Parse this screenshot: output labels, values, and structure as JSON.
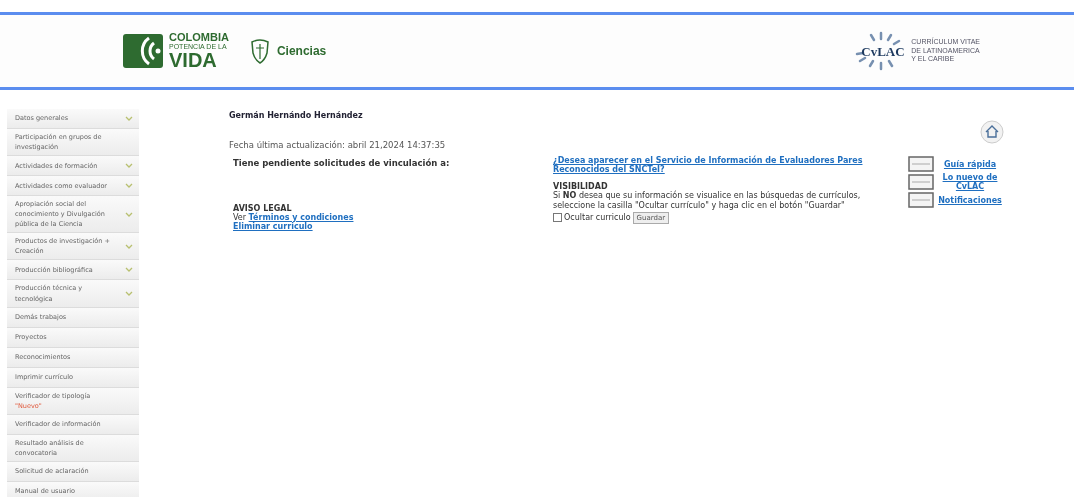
{
  "header": {
    "brand": {
      "line1": "COLOMBIA",
      "line2": "POTENCIA DE LA",
      "line3": "VIDA"
    },
    "ministry": "Ciencias",
    "cvlac_logo": "CvLAC",
    "cvlac_text": [
      "CURRÍCULUM VITAE",
      "DE LATINOAMERICA",
      "Y EL CARIBE"
    ]
  },
  "sidebar": {
    "items": [
      {
        "label": "Datos generales",
        "expandable": true
      },
      {
        "label": "Participación en grupos de investigación",
        "expandable": false
      },
      {
        "label": "Actividades de formación",
        "expandable": true
      },
      {
        "label": "Actividades como evaluador",
        "expandable": true
      },
      {
        "label": "Apropiación social del conocimiento y Divulgación pública de la Ciencia",
        "expandable": true
      },
      {
        "label": "Productos de investigación + Creación",
        "expandable": true
      },
      {
        "label": "Producción bibliográfica",
        "expandable": true
      },
      {
        "label": "Producción técnica y tecnológica",
        "expandable": true
      },
      {
        "label": "Demás trabajos",
        "expandable": false
      },
      {
        "label": "Proyectos",
        "expandable": false
      },
      {
        "label": "Reconocimientos",
        "expandable": false
      },
      {
        "label": "Imprimir currículo",
        "expandable": false
      },
      {
        "label": "Verificador de tipología",
        "badge": "\"Nuevo\"",
        "expandable": false
      },
      {
        "label": "Verificador de información",
        "expandable": false
      },
      {
        "label": "Resultado análisis de convocatoria",
        "expandable": false
      },
      {
        "label": "Solicitud de aclaración",
        "expandable": false
      },
      {
        "label": "Manual de usuario",
        "expandable": false
      }
    ]
  },
  "profile": {
    "name": "Germán Hernándo Hernández",
    "updated": "Fecha última actualización: abril 21,2024 14:37:35",
    "pending": "Tiene pendiente solicitudes de vinculación a:",
    "legal_title": "AVISO LEGAL",
    "terms_prefix": "Ver",
    "terms_link": "Términos y condiciones",
    "delete_link": "Eliminar curriculo"
  },
  "visibility": {
    "question_link": "¿Desea aparecer en el Servicio de Información de Evaluadores Pares Reconocidos del SNCTeI?",
    "title": "VISIBILIDAD",
    "text": "Si **NO** desea que su información se visualice en las búsquedas de currículos, seleccione la casilla \"Ocultar currículo\" y haga clic en el botón \"Guardar\"",
    "checkbox_label": "Ocultar curriculo",
    "checked": false,
    "save_button": "Guardar"
  },
  "help_links": [
    "Guía rápida",
    "Lo nuevo de CvLAC",
    "Notificaciones"
  ]
}
